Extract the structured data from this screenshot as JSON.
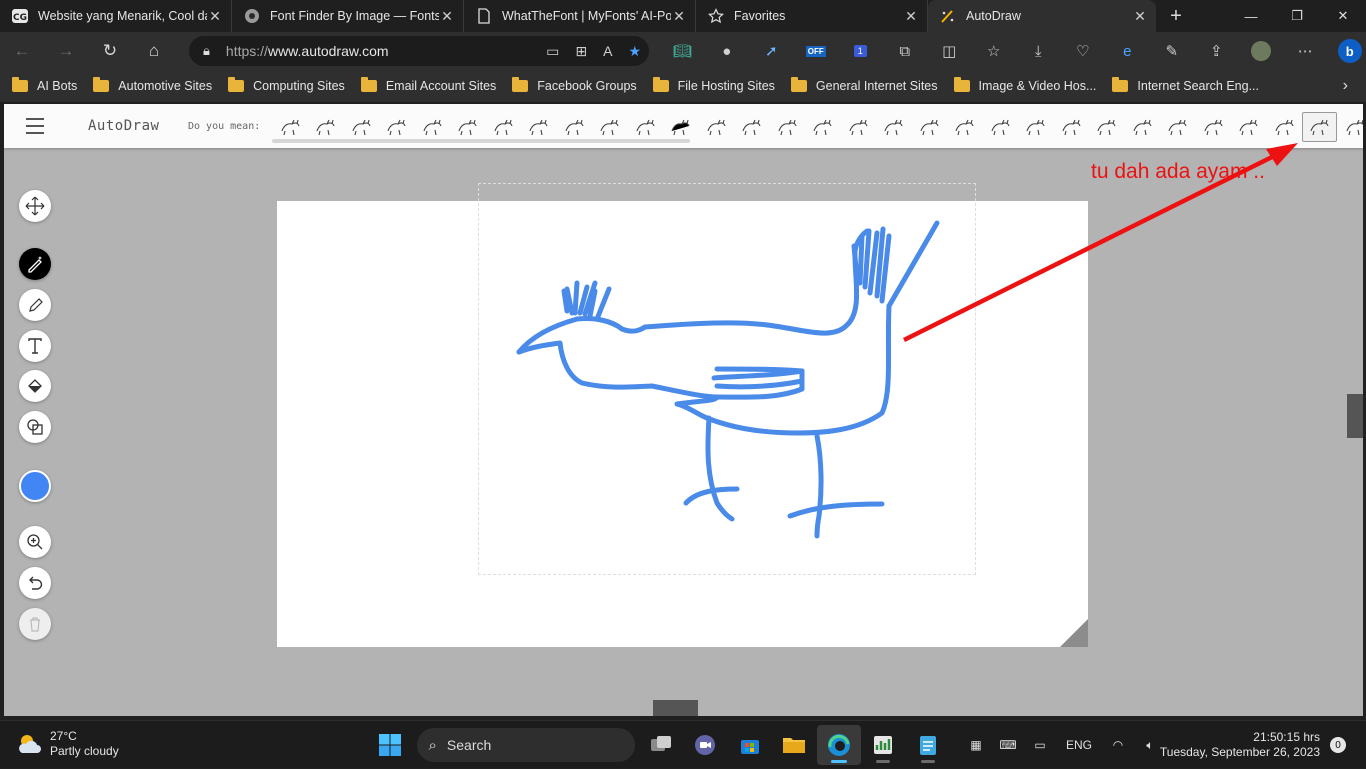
{
  "browser": {
    "tabs": [
      {
        "title": "Website yang Menarik, Cool da",
        "icon": "cg-icon"
      },
      {
        "title": "Font Finder By Image — Fontsp",
        "icon": "fontspring-icon"
      },
      {
        "title": "WhatTheFont | MyFonts' AI-Pov",
        "icon": "page-icon"
      },
      {
        "title": "Favorites",
        "icon": "star-icon"
      },
      {
        "title": "AutoDraw",
        "icon": "autodraw-icon"
      }
    ],
    "url_protocol": "https://",
    "url_host": "www.autodraw.com",
    "bookmarks": [
      {
        "label": "AI Bots"
      },
      {
        "label": "Automotive Sites"
      },
      {
        "label": "Computing Sites"
      },
      {
        "label": "Email Account Sites"
      },
      {
        "label": "Facebook Groups"
      },
      {
        "label": "File Hosting Sites"
      },
      {
        "label": "General Internet Sites"
      },
      {
        "label": "Image & Video Hos..."
      },
      {
        "label": "Internet Search Eng..."
      }
    ],
    "extension_badge_off": "OFF",
    "extension_badge_count": "1"
  },
  "autodraw": {
    "brand": "AutoDraw",
    "do_you_mean": "Do you mean:",
    "suggestions": [
      "creature",
      "deer",
      "plant",
      "turtle",
      "horse",
      "owl",
      "cat",
      "llama",
      "dog",
      "raccoon",
      "bird",
      "black-cat",
      "moose",
      "palm",
      "goat",
      "rat",
      "bat",
      "lizard",
      "house",
      "barn",
      "cube",
      "oval",
      "bread",
      "hotdog",
      "dog-2",
      "horse-2",
      "fox",
      "squirrel",
      "seahorse",
      "chicken",
      "eye"
    ],
    "selected_suggestion": "chicken",
    "pen_color": "#4285f4",
    "annotation": "tu dah ada ayam .."
  },
  "taskbar": {
    "temp": "27°C",
    "weather": "Partly cloudy",
    "search": "Search",
    "lang": "ENG",
    "time": "21:50:15 hrs",
    "date": "Tuesday, September 26, 2023",
    "notifications": "0"
  }
}
